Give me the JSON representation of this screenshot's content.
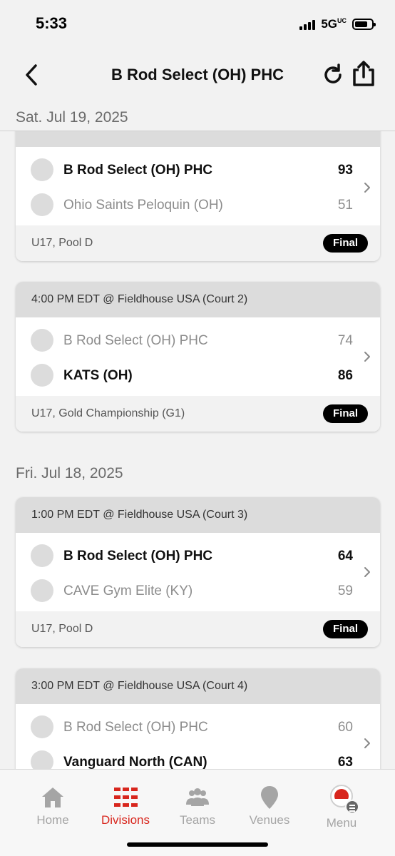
{
  "status_bar": {
    "time": "5:33",
    "network": "5G",
    "network_sub": "UC"
  },
  "nav": {
    "title": "B Rod Select (OH) PHC"
  },
  "sticky_date": "Sat. Jul 19, 2025",
  "games": [
    {
      "header": "",
      "teams": [
        {
          "name": "B Rod Select (OH) PHC",
          "score": "93",
          "winner": true
        },
        {
          "name": "Ohio Saints Peloquin (OH)",
          "score": "51",
          "winner": false
        }
      ],
      "division": "U17, Pool D",
      "status": "Final"
    },
    {
      "header": "4:00 PM EDT @ Fieldhouse USA (Court 2)",
      "teams": [
        {
          "name": "B Rod Select (OH) PHC",
          "score": "74",
          "winner": false
        },
        {
          "name": "KATS (OH)",
          "score": "86",
          "winner": true
        }
      ],
      "division": "U17, Gold Championship (G1)",
      "status": "Final"
    },
    {
      "header": "1:00 PM EDT @ Fieldhouse USA (Court 3)",
      "teams": [
        {
          "name": "B Rod Select (OH) PHC",
          "score": "64",
          "winner": true
        },
        {
          "name": "CAVE Gym Elite (KY)",
          "score": "59",
          "winner": false
        }
      ],
      "division": "U17, Pool D",
      "status": "Final"
    },
    {
      "header": "3:00 PM EDT @ Fieldhouse USA (Court 4)",
      "teams": [
        {
          "name": "B Rod Select (OH) PHC",
          "score": "60",
          "winner": false
        },
        {
          "name": "Vanguard North (CAN)",
          "score": "63",
          "winner": true
        }
      ],
      "division": "",
      "status": ""
    }
  ],
  "section_dates": [
    "Fri. Jul 18, 2025"
  ],
  "tabs": [
    {
      "label": "Home",
      "icon": "home-icon",
      "active": false
    },
    {
      "label": "Divisions",
      "icon": "divisions-icon",
      "active": true
    },
    {
      "label": "Teams",
      "icon": "teams-icon",
      "active": false
    },
    {
      "label": "Venues",
      "icon": "venues-icon",
      "active": false
    },
    {
      "label": "Menu",
      "icon": "menu-icon",
      "active": false
    }
  ],
  "colors": {
    "accent": "#d8261d",
    "card_header": "#dcdcdc",
    "badge": "#000000",
    "muted_text": "#8c8c8c"
  }
}
